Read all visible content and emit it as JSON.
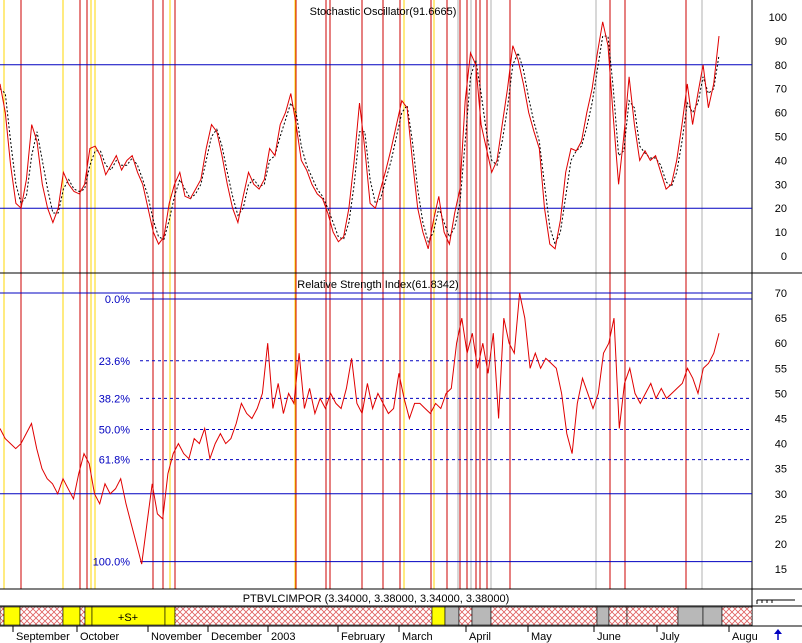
{
  "colors": {
    "price_line": "#e00000",
    "signal_line": "#000000",
    "level_line": "#0000c0",
    "marker_red": "#cc0000",
    "marker_yellow": "#ffd700",
    "marker_gray": "#b0b0b0",
    "signal_yellow": "#ffff00",
    "signal_gray": "#b8b8b8",
    "hatch_red": "#e06060"
  },
  "chart_data": [
    {
      "type": "line",
      "title": "Stochastic Oscillator(91.6665)",
      "ylim": [
        -10,
        100
      ],
      "yticks": [
        "100",
        "90",
        "80",
        "70",
        "60",
        "50",
        "40",
        "30",
        "20",
        "10",
        "0"
      ],
      "levels": [
        80,
        20
      ],
      "series": [
        {
          "style": "solid",
          "values": [
            72,
            60,
            38,
            22,
            20,
            32,
            55,
            48,
            30,
            20,
            14,
            20,
            35,
            30,
            27,
            26,
            30,
            45,
            46,
            42,
            34,
            38,
            42,
            36,
            40,
            42,
            35,
            30,
            20,
            10,
            5,
            8,
            22,
            30,
            35,
            25,
            24,
            28,
            32,
            45,
            55,
            52,
            42,
            30,
            20,
            14,
            25,
            35,
            30,
            28,
            32,
            45,
            42,
            55,
            60,
            68,
            55,
            40,
            36,
            30,
            26,
            24,
            18,
            10,
            6,
            8,
            20,
            40,
            64,
            45,
            22,
            20,
            28,
            36,
            45,
            55,
            65,
            62,
            40,
            20,
            10,
            3,
            15,
            25,
            10,
            5,
            18,
            28,
            65,
            85,
            80,
            55,
            45,
            35,
            40,
            55,
            70,
            88,
            82,
            72,
            60,
            52,
            45,
            20,
            5,
            3,
            15,
            35,
            45,
            44,
            48,
            60,
            70,
            85,
            98,
            88,
            58,
            30,
            50,
            75,
            55,
            40,
            44,
            40,
            42,
            35,
            28,
            30,
            40,
            55,
            72,
            55,
            68,
            80,
            62,
            72,
            92
          ]
        },
        {
          "style": "dotted",
          "values": [
            70,
            68,
            48,
            30,
            22,
            25,
            42,
            52,
            40,
            28,
            18,
            18,
            28,
            32,
            28,
            27,
            28,
            38,
            44,
            44,
            38,
            36,
            40,
            38,
            38,
            41,
            38,
            32,
            25,
            15,
            8,
            7,
            15,
            25,
            32,
            28,
            24,
            26,
            30,
            40,
            50,
            53,
            46,
            35,
            25,
            17,
            20,
            30,
            32,
            29,
            30,
            40,
            42,
            50,
            57,
            64,
            60,
            46,
            38,
            33,
            28,
            25,
            20,
            14,
            8,
            7,
            14,
            30,
            52,
            52,
            32,
            22,
            24,
            32,
            40,
            50,
            60,
            63,
            48,
            28,
            14,
            6,
            10,
            20,
            14,
            8,
            12,
            22,
            48,
            75,
            82,
            68,
            52,
            40,
            38,
            48,
            62,
            80,
            85,
            78,
            66,
            56,
            48,
            30,
            12,
            5,
            10,
            25,
            40,
            44,
            46,
            54,
            64,
            78,
            92,
            92,
            70,
            42,
            44,
            65,
            62,
            46,
            43,
            41,
            41,
            38,
            31,
            29,
            35,
            48,
            64,
            60,
            64,
            75,
            68,
            70,
            84
          ]
        }
      ]
    },
    {
      "type": "line",
      "title": "Relative Strength Index(61.8342)",
      "ylim": [
        11,
        72
      ],
      "yticks": [
        "70",
        "65",
        "60",
        "55",
        "50",
        "45",
        "40",
        "35",
        "30",
        "25",
        "20",
        "15"
      ],
      "levels": [
        70,
        30
      ],
      "fib_levels": [
        {
          "label": "0.0%",
          "value": 68.8
        },
        {
          "label": "23.6%",
          "value": 56.5
        },
        {
          "label": "38.2%",
          "value": 49
        },
        {
          "label": "50.0%",
          "value": 42.8
        },
        {
          "label": "61.8%",
          "value": 36.8
        },
        {
          "label": "100.0%",
          "value": 16.5
        }
      ],
      "series": [
        {
          "style": "solid",
          "values": [
            43,
            41,
            40,
            39,
            40,
            42,
            44,
            39,
            35,
            33,
            32,
            30,
            33,
            31,
            29,
            34,
            38,
            36,
            30,
            28,
            32,
            30,
            31,
            33,
            28,
            24,
            20,
            16,
            24,
            32,
            26,
            25,
            34,
            38,
            40,
            38,
            37,
            41,
            40,
            43,
            37,
            40,
            42,
            40,
            41,
            44,
            48,
            46,
            45,
            47,
            50,
            60,
            47,
            52,
            46,
            50,
            48,
            58,
            47,
            51,
            46,
            49,
            47,
            50,
            48,
            47,
            51,
            57,
            48,
            46,
            52,
            47,
            50,
            48,
            46,
            47,
            54,
            49,
            45,
            48,
            48,
            47,
            46,
            48,
            47,
            50,
            51,
            60,
            65,
            58,
            62,
            55,
            60,
            54,
            62,
            45,
            65,
            60,
            58,
            70,
            65,
            55,
            58,
            55,
            57,
            56,
            55,
            50,
            42,
            38,
            48,
            53,
            50,
            47,
            50,
            58,
            60,
            65,
            43,
            52,
            55,
            50,
            48,
            50,
            52,
            49,
            51,
            49,
            50,
            51,
            52,
            55,
            53,
            50,
            55,
            56,
            58,
            62
          ]
        }
      ]
    },
    {
      "type": "table",
      "title": "PTBVLCIMPOR (3.34000, 3.38000, 3.34000, 3.38000)",
      "signal_label": "+S+"
    }
  ],
  "x_axis": {
    "months": [
      "September",
      "October",
      "November",
      "December",
      "2003",
      "February",
      "March",
      "April",
      "May",
      "June",
      "July",
      "Augu"
    ]
  }
}
